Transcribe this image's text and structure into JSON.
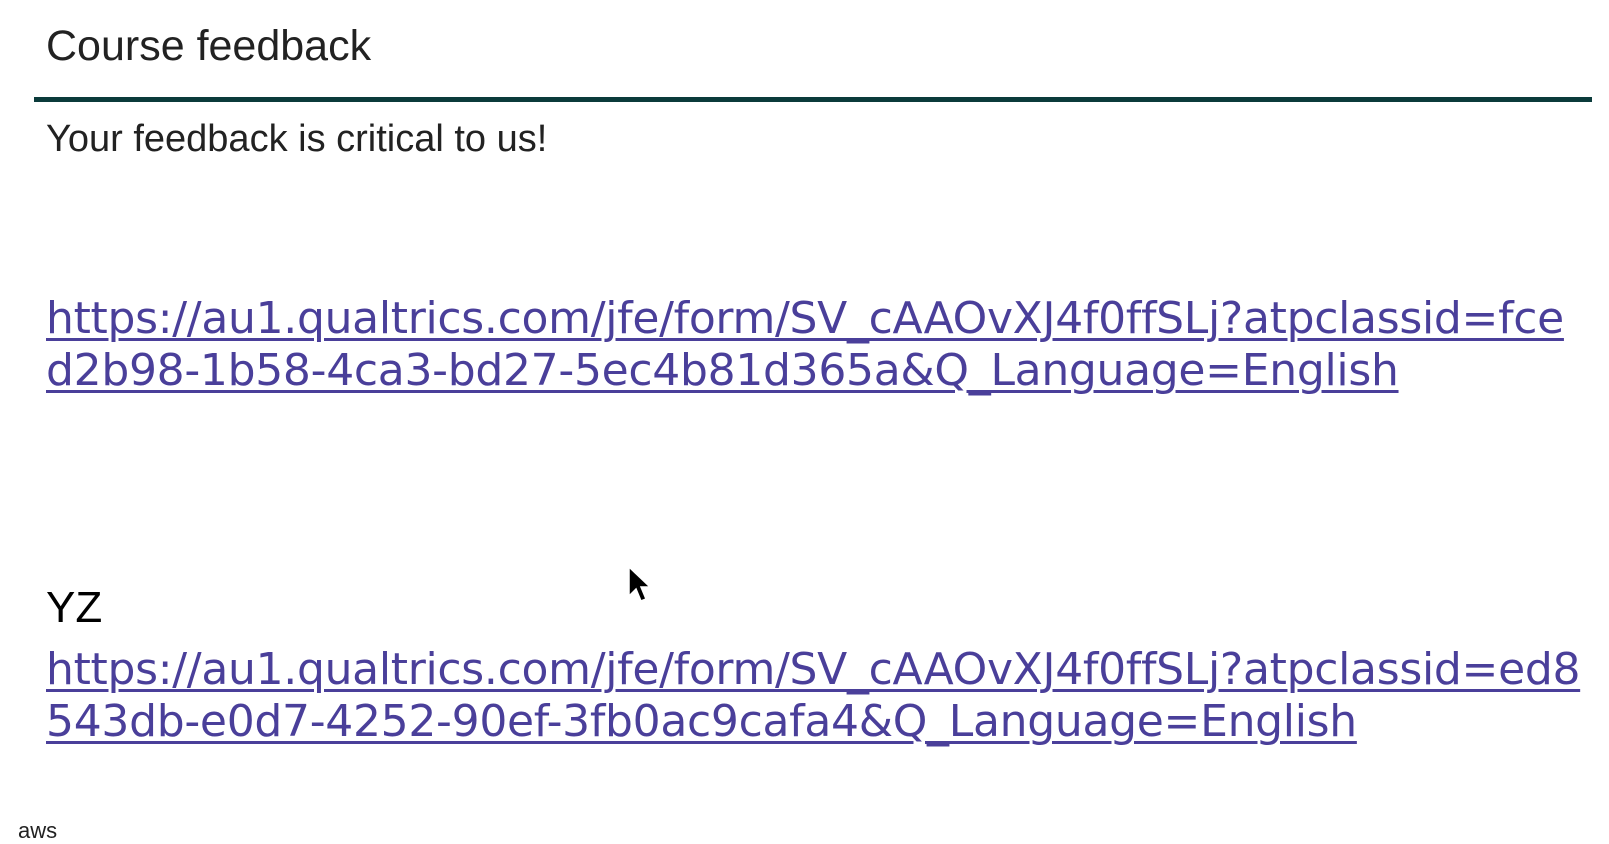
{
  "header": {
    "title": "Course feedback",
    "accent_color": "#0b3b3b"
  },
  "intro": "Your feedback is critical to us!",
  "links": [
    {
      "label": "",
      "url": "https://au1.qualtrics.com/jfe/form/SV_cAAOvXJ4f0ffSLj?atpclassid=fced2b98-1b58-4ca3-bd27-5ec4b81d365a&Q_Language=English"
    },
    {
      "label": "YZ",
      "url": "https://au1.qualtrics.com/jfe/form/SV_cAAOvXJ4f0ffSLj?atpclassid=ed8543db-e0d7-4252-90ef-3fb0ac9cafa4&Q_Language=English"
    }
  ],
  "footer": {
    "logo_text": "aws"
  },
  "link_color": "#4a3f9a"
}
